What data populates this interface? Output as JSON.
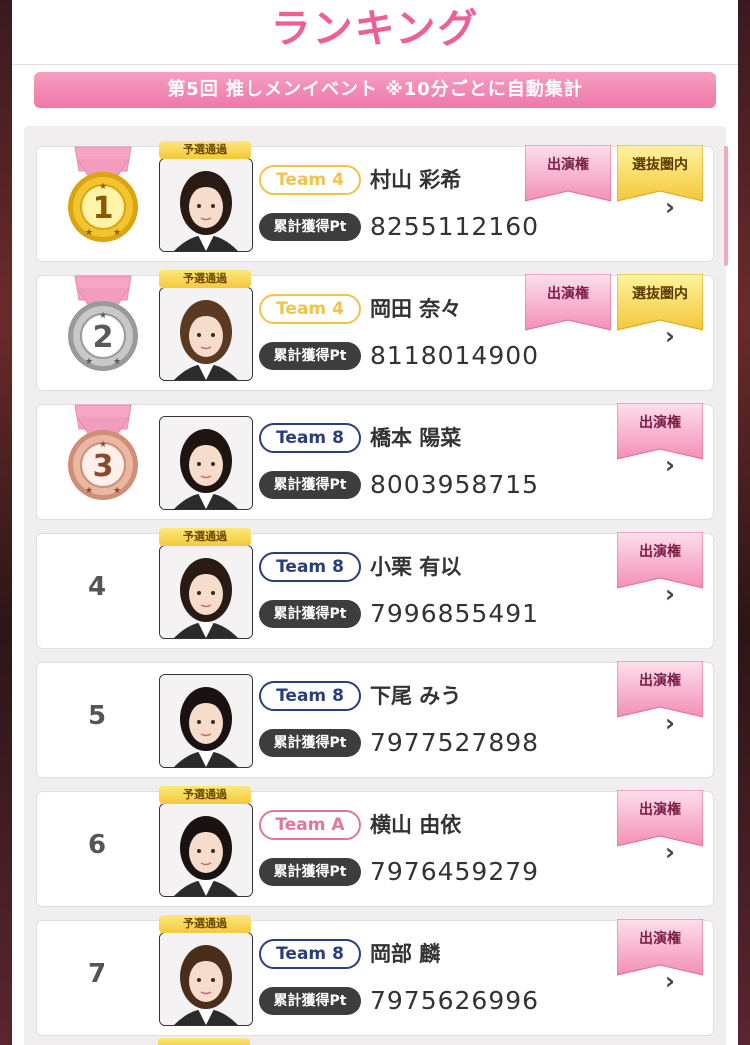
{
  "header": {
    "title": "ランキング"
  },
  "event_bar": {
    "label": "第5回 推しメンイベント ※10分ごとに自動集計"
  },
  "labels": {
    "points_label": "累計獲得Pt",
    "qualified": "予選通過",
    "flag_appearance": "出演権",
    "flag_selection": "選抜圏内",
    "chevron": "›"
  },
  "colors": {
    "accent_pink": "#ee5f97",
    "team4": "#f1c34a",
    "team8": "#2a3f7a",
    "teamA": "#e1769c"
  },
  "rows": [
    {
      "rank": "1",
      "medal": "gold",
      "qualified": true,
      "team": "Team 4",
      "name": "村山 彩希",
      "points": "8255112160",
      "appearance": true,
      "selection": true
    },
    {
      "rank": "2",
      "medal": "silver",
      "qualified": true,
      "team": "Team 4",
      "name": "岡田 奈々",
      "points": "8118014900",
      "appearance": true,
      "selection": true
    },
    {
      "rank": "3",
      "medal": "bronze",
      "qualified": false,
      "team": "Team 8",
      "name": "橋本 陽菜",
      "points": "8003958715",
      "appearance": true,
      "selection": false
    },
    {
      "rank": "4",
      "medal": "",
      "qualified": true,
      "team": "Team 8",
      "name": "小栗 有以",
      "points": "7996855491",
      "appearance": true,
      "selection": false
    },
    {
      "rank": "5",
      "medal": "",
      "qualified": false,
      "team": "Team 8",
      "name": "下尾 みう",
      "points": "7977527898",
      "appearance": true,
      "selection": false
    },
    {
      "rank": "6",
      "medal": "",
      "qualified": true,
      "team": "Team A",
      "name": "横山 由依",
      "points": "7976459279",
      "appearance": true,
      "selection": false
    },
    {
      "rank": "7",
      "medal": "",
      "qualified": true,
      "team": "Team 8",
      "name": "岡部 麟",
      "points": "7975626996",
      "appearance": true,
      "selection": false
    }
  ]
}
